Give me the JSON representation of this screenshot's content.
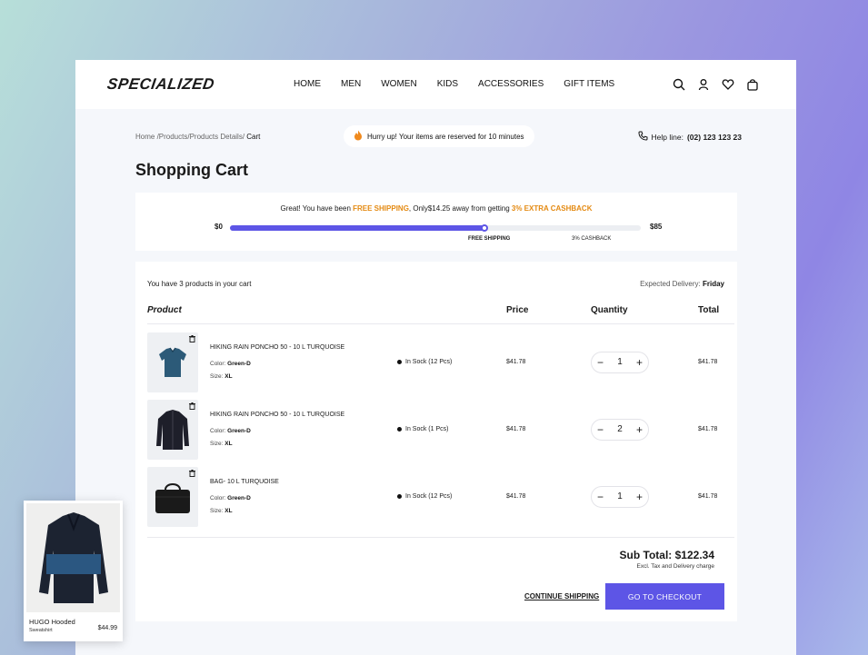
{
  "brand": {
    "logo": "SPECIALIZED"
  },
  "nav": [
    "HOME",
    "MEN",
    "WOMEN",
    "KIDS",
    "ACCESSORIES",
    "GIFT ITEMS"
  ],
  "header_icons": [
    "search-icon",
    "user-icon",
    "heart-icon",
    "bag-icon"
  ],
  "breadcrumb": {
    "path": "Home /Products/Products Details/",
    "current": " Cart"
  },
  "urgency": {
    "text": "Hurry up! Your items are reserved for 10 minutes"
  },
  "help": {
    "label": "Help line:",
    "phone": "(02) 123 123 23"
  },
  "page_title": "Shopping Cart",
  "shipping": {
    "prefix": "Great! You have been ",
    "free": "FREE SHIPPING",
    "middle": ", Only$14.25 away from getting ",
    "cashback": "3% EXTRA CASHBACK",
    "min": "$0",
    "max": "$85",
    "progress": 0.62,
    "milestone_free": "FREE SHIPPING",
    "milestone_cashback": "3% CASHBACK",
    "accent": "#5d55e6",
    "highlight": "#e48a12"
  },
  "cart": {
    "count_text": "You have 3 products in your cart",
    "delivery_label": "Expected Delivery: ",
    "delivery_day": "Friday",
    "headers": {
      "product": "Product",
      "price": "Price",
      "quantity": "Quantity",
      "total": "Total"
    },
    "items": [
      {
        "name": "HIKING RAIN PONCHO 50 - 10 L TURQUOISE",
        "color_label": "Color: ",
        "color": "Green-D",
        "size_label": "Size: ",
        "size": "XL",
        "stock": "In Sock (12 Pcs)",
        "price": "$41.78",
        "qty": "1",
        "total": "$41.78",
        "thumb": "polo-shirt"
      },
      {
        "name": "HIKING RAIN PONCHO 50 - 10 L TURQUOISE",
        "color_label": "Color: ",
        "color": "Green-D",
        "size_label": "Size: ",
        "size": "XL",
        "stock": "In Sock (1 Pcs)",
        "price": "$41.78",
        "qty": "2",
        "total": "$41.78",
        "thumb": "jacket"
      },
      {
        "name": "BAG- 10 L TURQUOISE",
        "color_label": "Color: ",
        "color": "Green-D",
        "size_label": "Size: ",
        "size": "XL",
        "stock": "In Sock (12 Pcs)",
        "price": "$41.78",
        "qty": "1",
        "total": "$41.78",
        "thumb": "bag"
      }
    ],
    "subtotal": "Sub Total: $122.34",
    "excl": "Excl. Tax and Delivery charge",
    "continue": "CONTINUE SHIPPING",
    "checkout": "GO TO CHECKOUT"
  },
  "popup": {
    "name": "HUGO Hooded",
    "sub": "Sweatshirt",
    "price": "$44.99"
  }
}
